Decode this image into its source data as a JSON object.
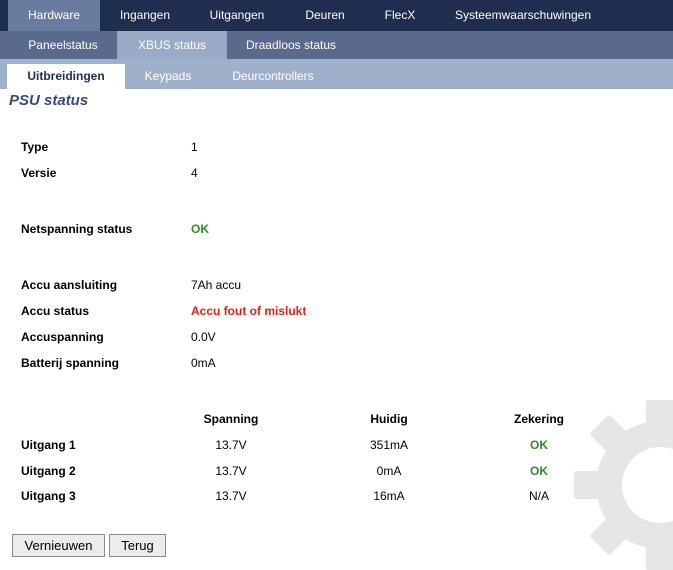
{
  "nav": {
    "primary": [
      {
        "label": "Hardware",
        "active": true
      },
      {
        "label": "Ingangen",
        "active": false
      },
      {
        "label": "Uitgangen",
        "active": false
      },
      {
        "label": "Deuren",
        "active": false
      },
      {
        "label": "FlecX",
        "active": false
      },
      {
        "label": "Systeemwaarschuwingen",
        "active": false
      }
    ],
    "secondary": [
      {
        "label": "Paneelstatus",
        "active": false
      },
      {
        "label": "XBUS status",
        "active": true
      },
      {
        "label": "Draadloos status",
        "active": false
      }
    ],
    "tertiary": [
      {
        "label": "Uitbreidingen",
        "active": true
      },
      {
        "label": "Keypads",
        "active": false
      },
      {
        "label": "Deurcontrollers",
        "active": false
      }
    ]
  },
  "page": {
    "title": "PSU status"
  },
  "info": {
    "type": {
      "label": "Type",
      "value": "1"
    },
    "versie": {
      "label": "Versie",
      "value": "4"
    },
    "netspanning": {
      "label": "Netspanning status",
      "value": "OK"
    },
    "accu_aansluiting": {
      "label": "Accu aansluiting",
      "value": "7Ah accu"
    },
    "accu_status": {
      "label": "Accu status",
      "value": "Accu fout of mislukt"
    },
    "accuspanning": {
      "label": "Accuspanning",
      "value": "0.0V"
    },
    "batterij_spanning": {
      "label": "Batterij spanning",
      "value": "0mA"
    }
  },
  "outputs": {
    "headers": [
      "Spanning",
      "Huidig",
      "Zekering"
    ],
    "rows": [
      {
        "name": "Uitgang 1",
        "spanning": "13.7V",
        "huidig": "351mA",
        "zekering": "OK"
      },
      {
        "name": "Uitgang 2",
        "spanning": "13.7V",
        "huidig": "0mA",
        "zekering": "OK"
      },
      {
        "name": "Uitgang 3",
        "spanning": "13.7V",
        "huidig": "16mA",
        "zekering": "N/A"
      }
    ]
  },
  "buttons": {
    "refresh": "Vernieuwen",
    "back": "Terug"
  },
  "colors": {
    "nav_dark": "#1f2d4f",
    "ok": "#2e8b2e",
    "error": "#e0201f",
    "title": "#3a4a78"
  },
  "icons": {
    "watermark": "gear-icon"
  }
}
